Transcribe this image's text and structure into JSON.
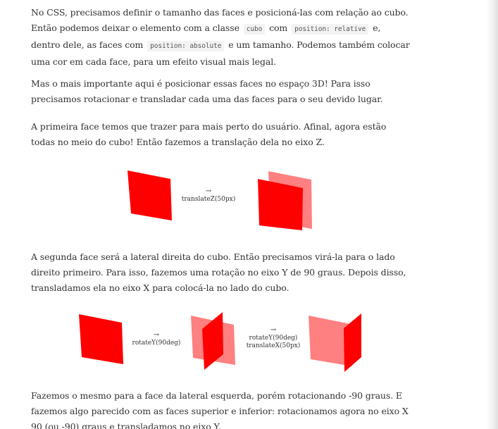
{
  "paragraphs": {
    "p1": {
      "before_code1": "No CSS, precisamos definir o tamanho das faces e posicioná-las com relação ao cubo. Então podemos deixar o elemento com a classe",
      "code1": "cubo",
      "between_1_2": "com",
      "code2": "position: relative",
      "between_2_3": "e, dentro dele, as faces com",
      "code3": "position: absolute",
      "after_code3": "e um tamanho. Podemos também colocar uma cor em cada face, para um efeito visual mais legal."
    },
    "p2": "Mas o mais importante aqui é posicionar essas faces no espaço 3D! Para isso precisamos rotacionar e transladar cada uma das faces para o seu devido lugar.",
    "p3": "A primeira face temos que trazer para mais perto do usuário. Afinal, agora estão todas no meio do cubo! Então fazemos a translação dela no eixo Z.",
    "p4": "A segunda face será a lateral direita do cubo. Então precisamos virá-la para o lado direito primeiro. Para isso, fazemos uma rotação no eixo Y de 90 graus. Depois disso, transladamos ela no eixo X para colocá-la no lado do cubo.",
    "p5": "Fazemos o mesmo para a face da lateral esquerda, porém rotacionando -90 graus. E fazemos algo parecido com as faces superior e inferior: rotacionamos agora no eixo X 90 (ou -90) graus e transladamos no eixo Y."
  },
  "illustrations": {
    "fig1": {
      "arrow": "→",
      "label": "translateZ(50px)"
    },
    "fig2": {
      "arrow1": "→",
      "label1": "rotateY(90deg)",
      "arrow2": "→",
      "label2_line1": "rotateY(90deg)",
      "label2_line2": "translateX(50px)"
    }
  },
  "colors": {
    "face_solid": "#ff0000",
    "face_faded": "#ff8080",
    "text": "#333333",
    "code_bg": "#f3f3f3"
  }
}
